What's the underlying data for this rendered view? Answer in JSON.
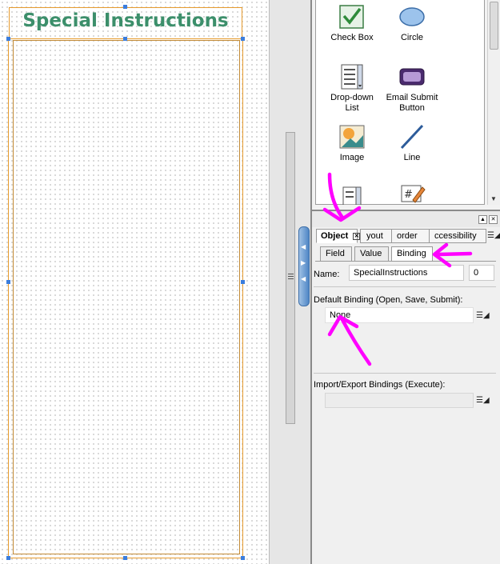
{
  "canvas": {
    "title": "Special Instructions"
  },
  "toolbox": {
    "items": [
      {
        "label": "Check Box",
        "icon": "check-box-icon"
      },
      {
        "label": "Circle",
        "icon": "circle-icon"
      },
      {
        "label": "Drop-down\nList",
        "icon": "drop-down-list-icon"
      },
      {
        "label": "Email Submit\nButton",
        "icon": "email-submit-button-icon"
      },
      {
        "label": "Image",
        "icon": "image-icon"
      },
      {
        "label": "Line",
        "icon": "line-icon"
      }
    ]
  },
  "properties": {
    "top_tabs": [
      "Object",
      "Layout",
      "Border",
      "Accessibility"
    ],
    "top_tabs_visible": [
      "Object",
      "yout",
      "order",
      "ccessibility"
    ],
    "sub_tabs": [
      "Field",
      "Value",
      "Binding"
    ],
    "active_top_tab": "Object",
    "active_sub_tab": "Binding",
    "name_label": "Name:",
    "name_value": "SpecialInstructions",
    "name_index": "0",
    "default_binding_label": "Default Binding (Open, Save, Submit):",
    "default_binding_value": "None",
    "import_export_label": "Import/Export Bindings (Execute):",
    "import_export_value": ""
  },
  "colors": {
    "title_text": "#3c8f6b",
    "frame_border": "#e69b2e",
    "annotation": "#ff00ff",
    "selection_handle": "#3b7ddd"
  }
}
